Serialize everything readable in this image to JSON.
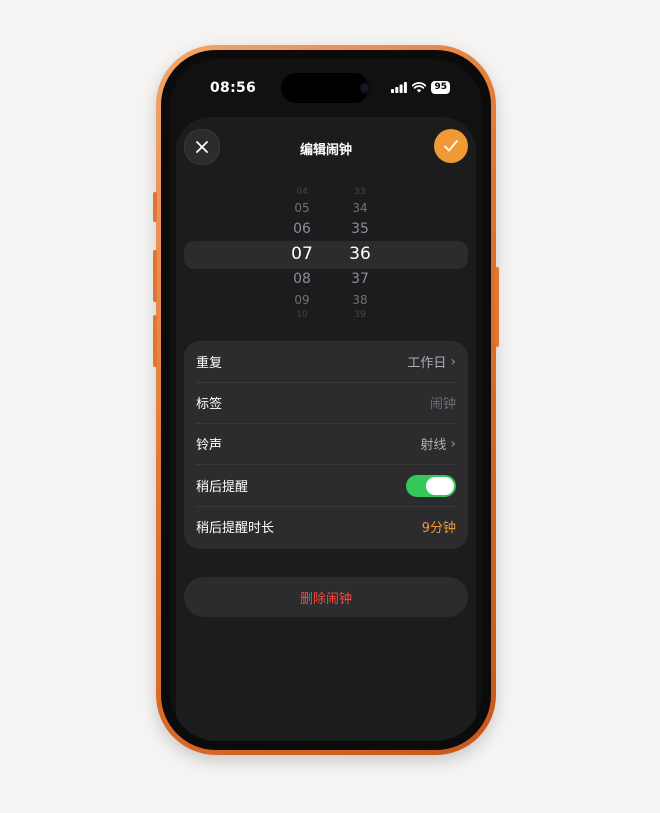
{
  "status_bar": {
    "time": "08:56",
    "battery": "95"
  },
  "header": {
    "title": "编辑闹钟",
    "close_icon": "close-icon",
    "confirm_icon": "checkmark-icon"
  },
  "picker": {
    "hours": [
      "04",
      "05",
      "06",
      "07",
      "08",
      "09",
      "10"
    ],
    "minutes": [
      "33",
      "34",
      "35",
      "36",
      "37",
      "38",
      "39"
    ],
    "selected_hour": "07",
    "selected_minute": "36"
  },
  "settings": {
    "repeat": {
      "label": "重复",
      "value": "工作日"
    },
    "tag": {
      "label": "标签",
      "placeholder": "闹钟"
    },
    "ringtone": {
      "label": "铃声",
      "value": "射线"
    },
    "snooze": {
      "label": "稍后提醒",
      "enabled": true
    },
    "snooze_duration": {
      "label": "稍后提醒时长",
      "value": "9分钟"
    }
  },
  "delete_label": "删除闹钟",
  "colors": {
    "accent": "#f09a36",
    "toggle_on": "#34c759",
    "destructive": "#ff453a",
    "frame": "#e2742f"
  }
}
